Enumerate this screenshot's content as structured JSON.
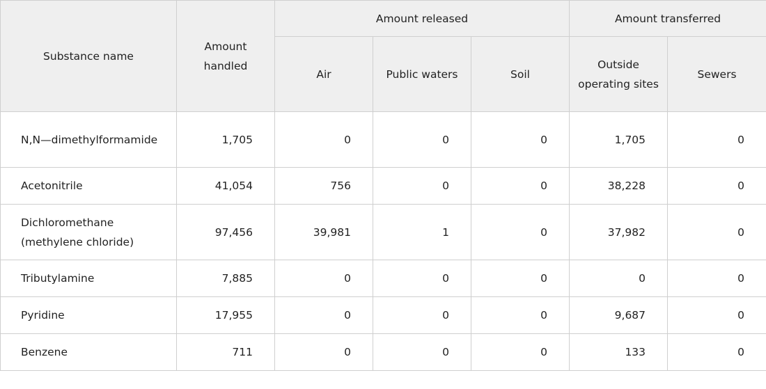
{
  "headers": {
    "substance_name": "Substance name",
    "amount_handled": "Amount handled",
    "amount_released": "Amount released",
    "amount_transferred": "Amount transferred",
    "air": "Air",
    "public_waters": "Public waters",
    "soil": "Soil",
    "outside_operating_sites": "Outside operating sites",
    "sewers": "Sewers"
  },
  "rows": [
    {
      "name": "N,N—dimethylformamide",
      "handled": "1,705",
      "air": "0",
      "public_waters": "0",
      "soil": "0",
      "outside": "1,705",
      "sewers": "0"
    },
    {
      "name": "Acetonitrile",
      "handled": "41,054",
      "air": "756",
      "public_waters": "0",
      "soil": "0",
      "outside": "38,228",
      "sewers": "0"
    },
    {
      "name": "Dichloromethane (methylene chloride)",
      "handled": "97,456",
      "air": "39,981",
      "public_waters": "1",
      "soil": "0",
      "outside": "37,982",
      "sewers": "0"
    },
    {
      "name": "Tributylamine",
      "handled": "7,885",
      "air": "0",
      "public_waters": "0",
      "soil": "0",
      "outside": "0",
      "sewers": "0"
    },
    {
      "name": "Pyridine",
      "handled": "17,955",
      "air": "0",
      "public_waters": "0",
      "soil": "0",
      "outside": "9,687",
      "sewers": "0"
    },
    {
      "name": "Benzene",
      "handled": "711",
      "air": "0",
      "public_waters": "0",
      "soil": "0",
      "outside": "133",
      "sewers": "0"
    }
  ]
}
